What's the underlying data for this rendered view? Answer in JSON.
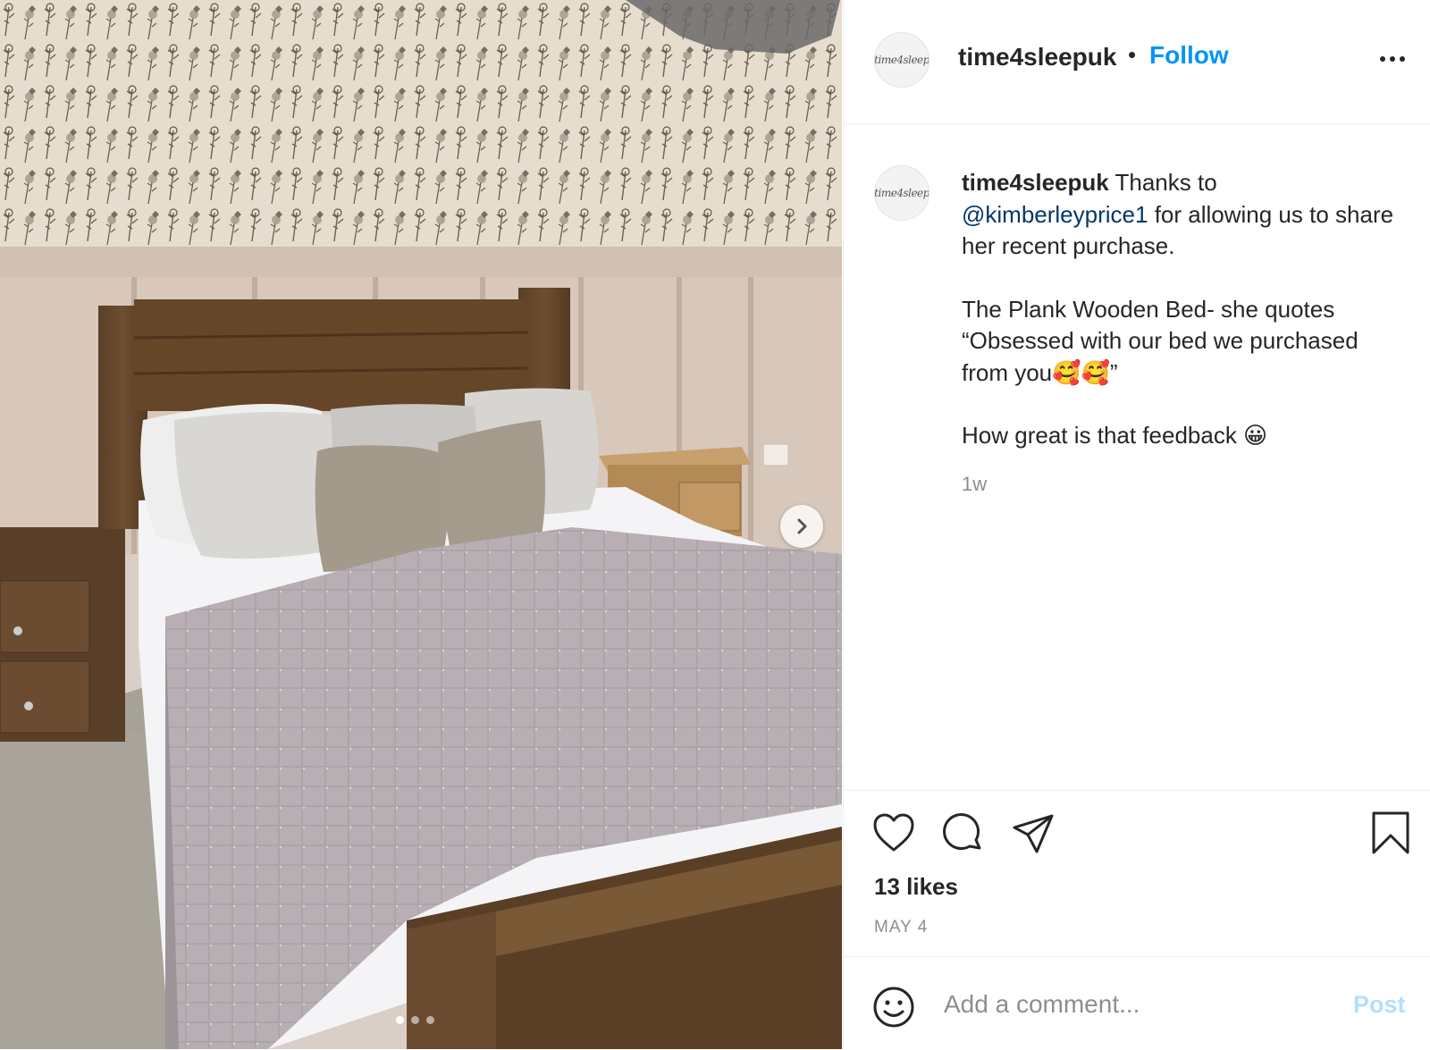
{
  "photo": {
    "alt": "Plank Wooden Bed bedroom photo",
    "slides": 3,
    "active_slide": 1,
    "next_icon": "chevron-right-icon"
  },
  "header": {
    "username": "time4sleepuk",
    "separator": "•",
    "follow_label": "Follow",
    "avatar_logo": "time4sleep",
    "more_icon": "more-horizontal-icon"
  },
  "caption": {
    "username": "time4sleepuk",
    "line1": " Thanks to ",
    "mention": "@kimberleyprice1",
    "line1b": " for allowing us to share her recent purchase.",
    "line2": "The Plank Wooden Bed- she quotes “Obsessed with our bed we purchased from you🥰🥰”",
    "line3": "How great is that feedback 😀",
    "time_ago": "1w"
  },
  "actions": {
    "like_icon": "heart-icon",
    "comment_icon": "comment-icon",
    "share_icon": "paper-plane-icon",
    "save_icon": "bookmark-icon",
    "likes": "13 likes",
    "date": "MAY 4"
  },
  "comment": {
    "placeholder": "Add a comment...",
    "post_label": "Post",
    "emoji_icon": "smiley-icon"
  },
  "colors": {
    "link": "#0095f6",
    "mention": "#00376b",
    "post_disabled": "#b2dffc",
    "muted": "#8e8e8e"
  }
}
